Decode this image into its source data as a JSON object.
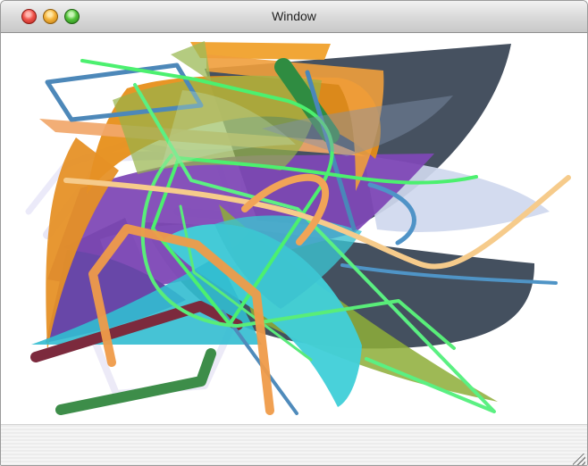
{
  "window": {
    "title": "Window"
  },
  "controls": {
    "close": "close-button",
    "minimize": "minimize-button",
    "zoom": "zoom-button"
  },
  "resize_handle": "resize-grip"
}
